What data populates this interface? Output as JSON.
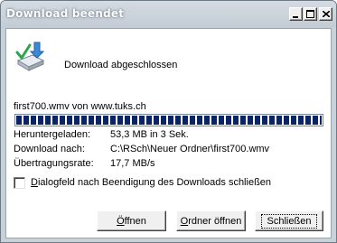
{
  "window": {
    "title": "Download beendet"
  },
  "header": {
    "status": "Download abgeschlossen",
    "icon": "download-complete-icon"
  },
  "download": {
    "file_line": "first700.wmv von www.tuks.ch",
    "progress_percent": 100,
    "rows": [
      {
        "label": "Heruntergeladen:",
        "value": "53,3 MB in 3 Sek."
      },
      {
        "label": "Download nach:",
        "value": "C:\\RSch\\Neuer Ordner\\first700.wmv"
      },
      {
        "label": "Übertragungsrate:",
        "value": "17,7 MB/s"
      }
    ]
  },
  "options": {
    "close_after_download_first": "D",
    "close_after_download_rest": "ialogfeld nach Beendigung des Downloads schließen",
    "checked": false
  },
  "buttons": {
    "open_first": "Ö",
    "open_rest": "ffnen",
    "folder_first": "O",
    "folder_rest": "rdner öffnen",
    "close_label": "Schließen"
  },
  "colors": {
    "progress": "#0a246a",
    "titlebar": "#c8d0d8"
  }
}
